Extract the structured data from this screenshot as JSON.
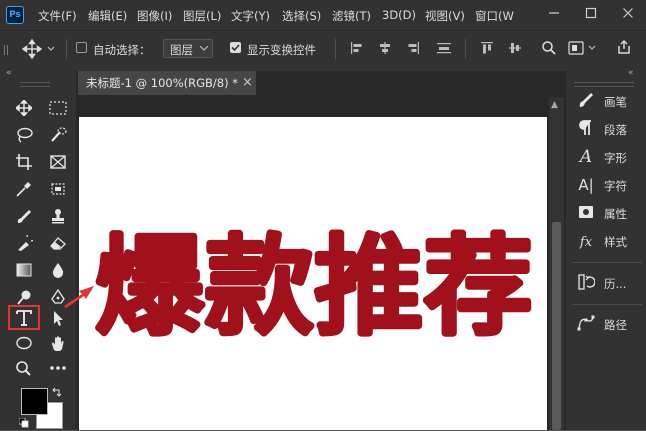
{
  "menubar": {
    "app_logo": "Ps",
    "items": [
      "文件(F)",
      "编辑(E)",
      "图像(I)",
      "图层(L)",
      "文字(Y)",
      "选择(S)",
      "滤镜(T)",
      "3D(D)",
      "视图(V)",
      "窗口(W"
    ],
    "window_controls": [
      "minimize",
      "maximize",
      "close"
    ]
  },
  "options_bar": {
    "auto_select_label": "自动选择：",
    "auto_select_checked": false,
    "auto_select_target": "图层",
    "show_transform_label": "显示变换控件",
    "show_transform_checked": true
  },
  "document": {
    "tab_title": "未标题-1 @ 100%(RGB/8) *",
    "tab_close": "×",
    "canvas_text": "爆款推荐",
    "canvas_text_color": "#a1111c",
    "annotation_color": "#e03333"
  },
  "toolbar": {
    "active_tool": "type-tool",
    "foreground_color": "#000000",
    "background_color": "#ffffff"
  },
  "panels": [
    {
      "icon": "brush-panel-icon",
      "label": "画笔"
    },
    {
      "icon": "paragraph-panel-icon",
      "label": "段落"
    },
    {
      "icon": "character-panel-icon",
      "label": "字形"
    },
    {
      "icon": "character-styles-icon",
      "label": "字符"
    },
    {
      "icon": "properties-icon",
      "label": "属性"
    },
    {
      "icon": "styles-icon",
      "label": "样式"
    },
    {
      "icon": "history-icon",
      "label": "历..."
    },
    {
      "icon": "paths-icon",
      "label": "路径"
    }
  ]
}
